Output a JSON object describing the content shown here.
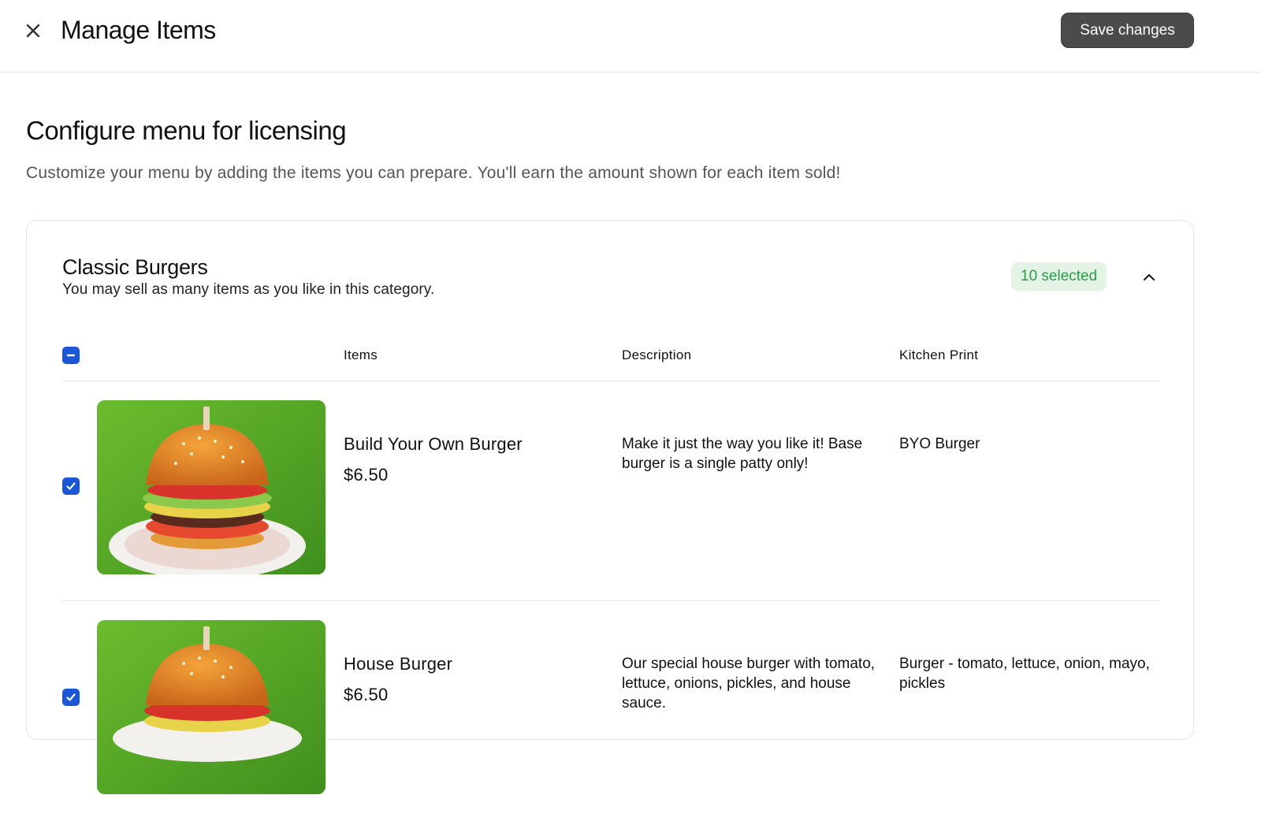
{
  "header": {
    "title": "Manage Items",
    "save_label": "Save changes"
  },
  "intro": {
    "title": "Configure menu for licensing",
    "subtitle": "Customize your menu by adding the items you can prepare. You'll earn the amount shown for each item sold!"
  },
  "category": {
    "title": "Classic Burgers",
    "subtitle": "You may sell as many items as you like in this category.",
    "badge": "10 selected",
    "expanded": true
  },
  "table": {
    "columns": [
      "Items",
      "Description",
      "Kitchen Print"
    ],
    "select_all_state": "indeterminate",
    "rows": [
      {
        "name": "Build Your Own Burger",
        "price": "$6.50",
        "description": "Make it just the way you like it! Base burger is a single patty only!",
        "kitchen_print": "BYO Burger",
        "checked": true
      },
      {
        "name": "House Burger",
        "price": "$6.50",
        "description": "Our special house burger with tomato, lettuce, onions, pickles, and house sauce.",
        "kitchen_print": "Burger - tomato, lettuce, onion, mayo, pickles",
        "checked": true
      }
    ]
  },
  "colors": {
    "save_button_bg": "#4b4b4b",
    "checkbox_blue": "#1a56d6",
    "badge_bg": "#e3f4e6",
    "badge_text": "#2f9a4a"
  }
}
